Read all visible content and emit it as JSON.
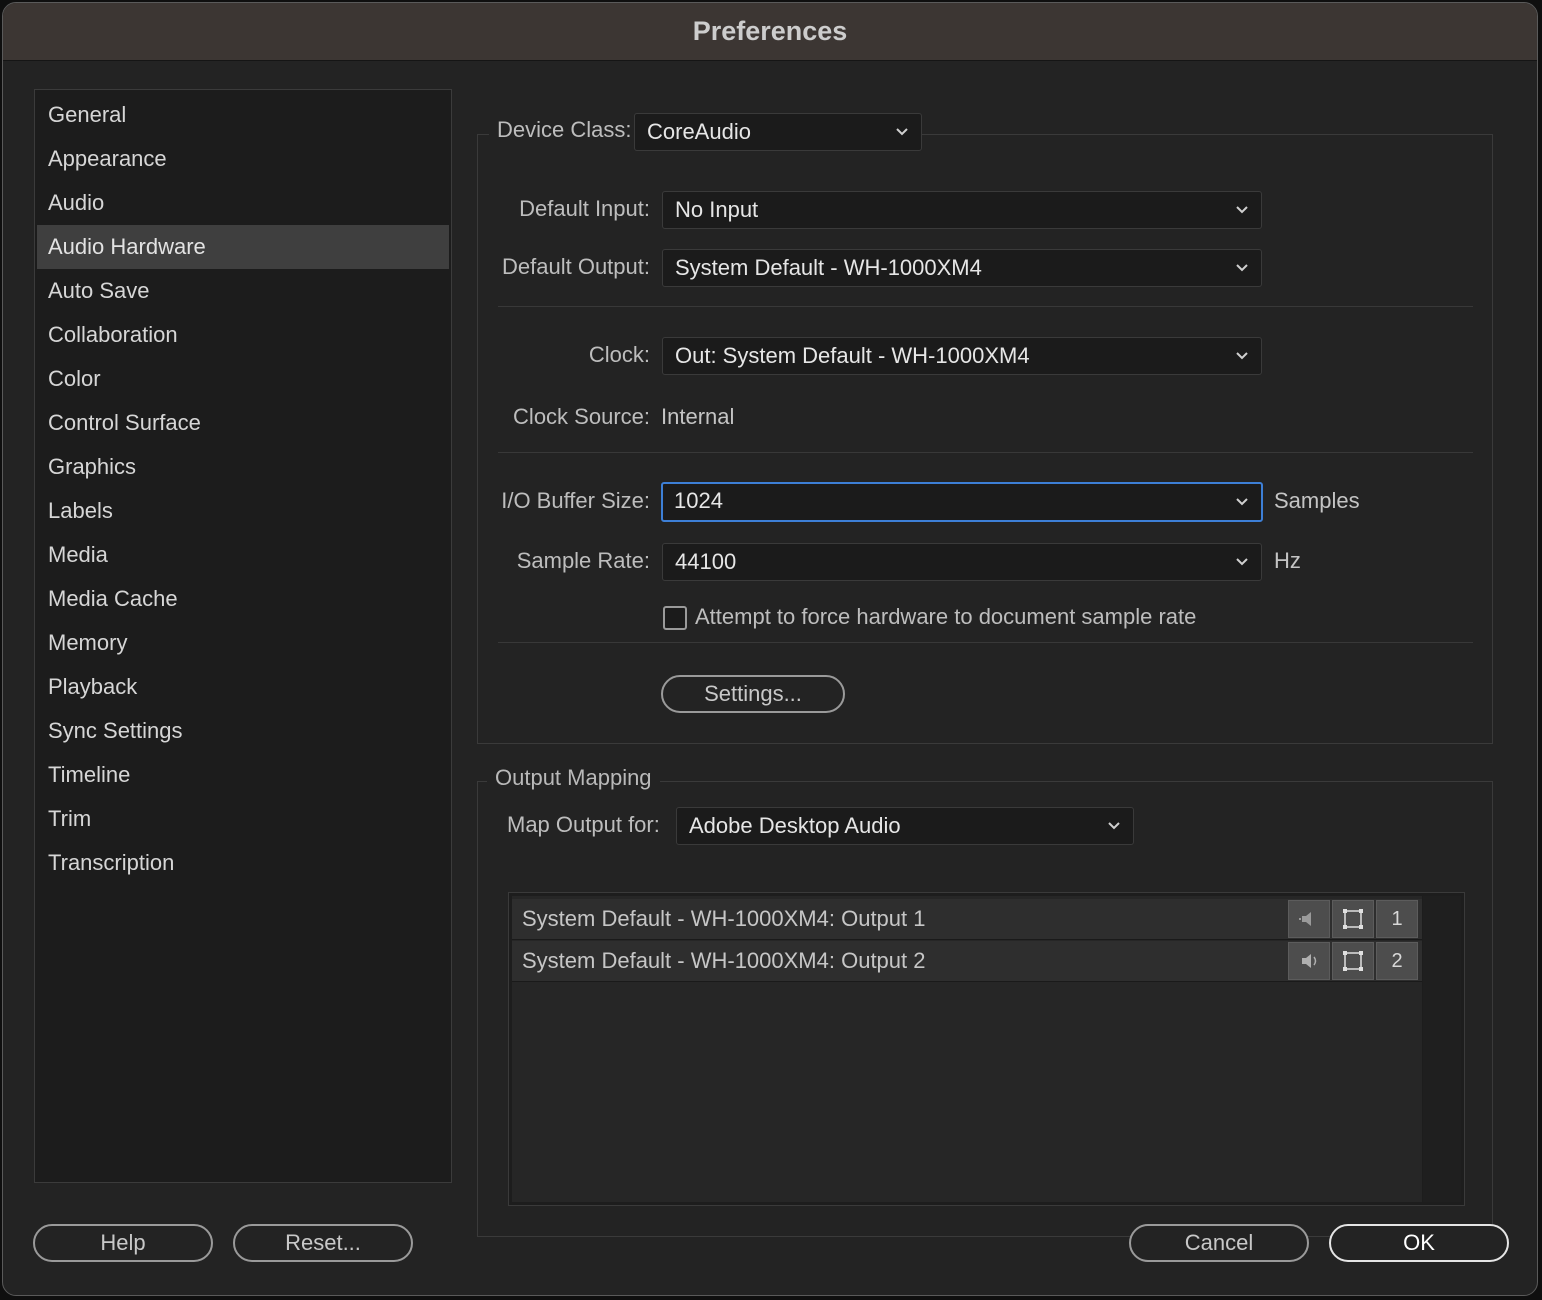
{
  "window": {
    "title": "Preferences"
  },
  "sidebar": {
    "items": [
      {
        "label": "General",
        "active": false
      },
      {
        "label": "Appearance",
        "active": false
      },
      {
        "label": "Audio",
        "active": false
      },
      {
        "label": "Audio Hardware",
        "active": true
      },
      {
        "label": "Auto Save",
        "active": false
      },
      {
        "label": "Collaboration",
        "active": false
      },
      {
        "label": "Color",
        "active": false
      },
      {
        "label": "Control Surface",
        "active": false
      },
      {
        "label": "Graphics",
        "active": false
      },
      {
        "label": "Labels",
        "active": false
      },
      {
        "label": "Media",
        "active": false
      },
      {
        "label": "Media Cache",
        "active": false
      },
      {
        "label": "Memory",
        "active": false
      },
      {
        "label": "Playback",
        "active": false
      },
      {
        "label": "Sync Settings",
        "active": false
      },
      {
        "label": "Timeline",
        "active": false
      },
      {
        "label": "Trim",
        "active": false
      },
      {
        "label": "Transcription",
        "active": false
      }
    ]
  },
  "device": {
    "device_class_label": "Device Class:",
    "device_class_value": "CoreAudio",
    "default_input_label": "Default Input:",
    "default_input_value": "No Input",
    "default_output_label": "Default Output:",
    "default_output_value": "System Default - WH-1000XM4",
    "clock_label": "Clock:",
    "clock_value": "Out: System Default - WH-1000XM4",
    "clock_source_label": "Clock Source:",
    "clock_source_value": "Internal",
    "buffer_label": "I/O Buffer Size:",
    "buffer_value": "1024",
    "buffer_unit": "Samples",
    "sample_rate_label": "Sample Rate:",
    "sample_rate_value": "44100",
    "sample_rate_unit": "Hz",
    "force_rate_label": "Attempt to force hardware to document sample rate",
    "force_rate_checked": false,
    "settings_button": "Settings..."
  },
  "output_mapping": {
    "legend": "Output Mapping",
    "map_for_label": "Map Output for:",
    "map_for_value": "Adobe Desktop Audio",
    "rows": [
      {
        "name": "System Default - WH-1000XM4: Output 1",
        "channel": "1"
      },
      {
        "name": "System Default - WH-1000XM4: Output 2",
        "channel": "2"
      }
    ]
  },
  "footer": {
    "help": "Help",
    "reset": "Reset...",
    "cancel": "Cancel",
    "ok": "OK"
  },
  "colors": {
    "accent_focus": "#3d7fd6",
    "titlebar": "#3c3633",
    "panel": "#232323",
    "selected_item": "#3f3f3f"
  }
}
